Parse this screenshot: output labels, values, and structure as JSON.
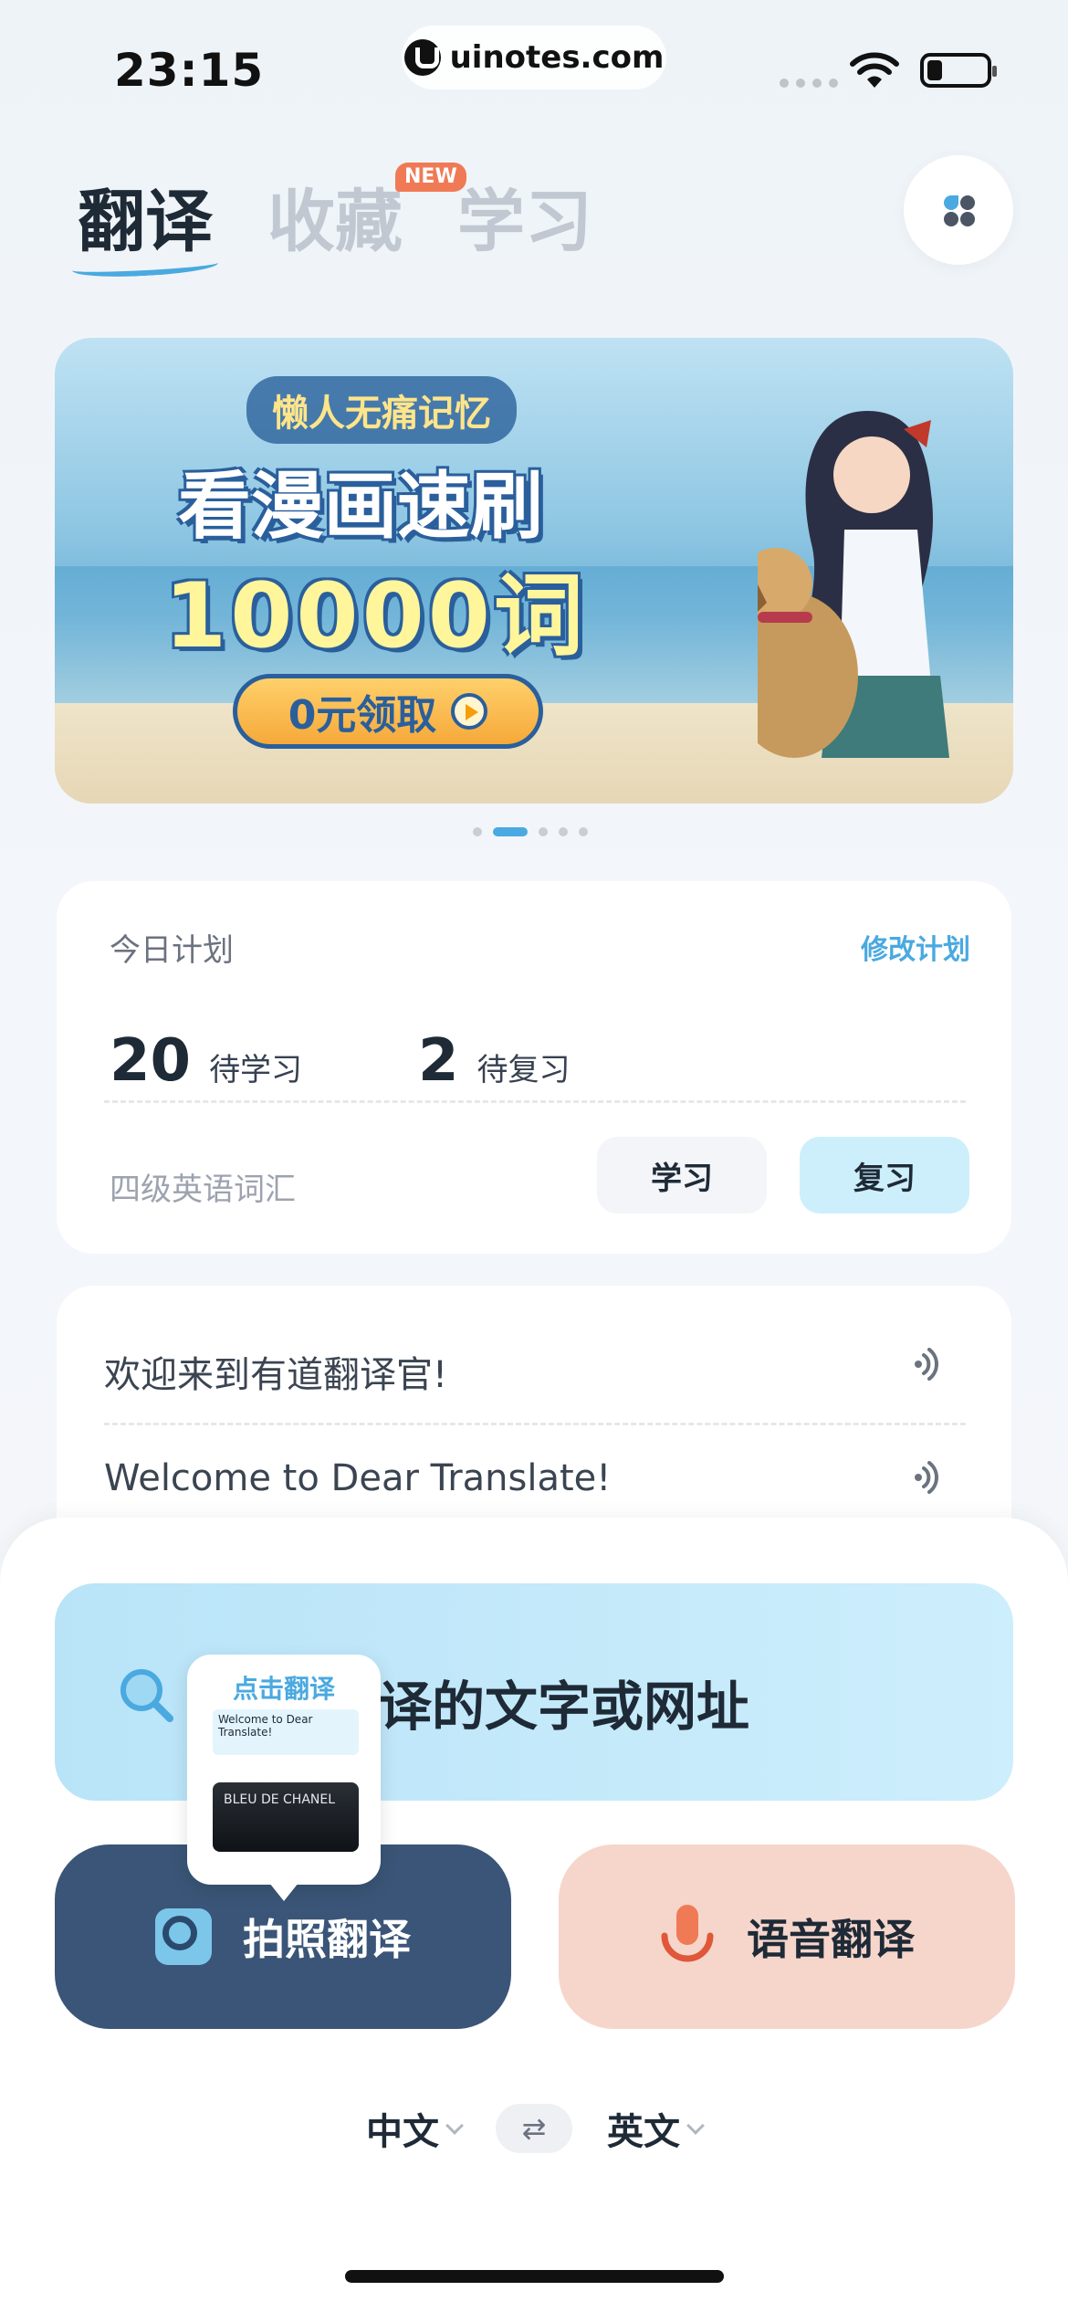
{
  "status_bar": {
    "time": "23:15",
    "url": "uinotes.com"
  },
  "header": {
    "tabs": [
      {
        "label": "翻译",
        "active": true
      },
      {
        "label": "收藏",
        "badge": "NEW"
      },
      {
        "label": "学习"
      }
    ],
    "menu_icon": "grid-dots-icon"
  },
  "banner": {
    "subtitle": "懒人无痛记忆",
    "title": "看漫画速刷",
    "words": "10000词",
    "cta": "0元领取",
    "page_count": 5,
    "active_index": 1
  },
  "plan": {
    "title": "今日计划",
    "edit_label": "修改计划",
    "to_learn_count": "20",
    "to_learn_label": "待学习",
    "to_review_count": "2",
    "to_review_label": "待复习",
    "book": "四级英语词汇",
    "study_button": "学习",
    "review_button": "复习"
  },
  "welcome": {
    "lines": [
      "欢迎来到有道翻译官!",
      "Welcome to Dear Translate!"
    ]
  },
  "translate": {
    "search_text": "译的文字或网址",
    "tooltip_title": "点击翻译",
    "tooltip_preview": "Welcome to Dear Translate!",
    "tooltip_photo": "BLEU DE CHANEL",
    "photo_label": "拍照翻译",
    "voice_label": "语音翻译",
    "source_lang": "中文",
    "target_lang": "英文",
    "swap_symbol": "⇄"
  },
  "colors": {
    "accent": "#4aa9e0",
    "photo_button": "#3a5577",
    "voice_button": "#f6d6cb",
    "badge": "#f07a55"
  }
}
